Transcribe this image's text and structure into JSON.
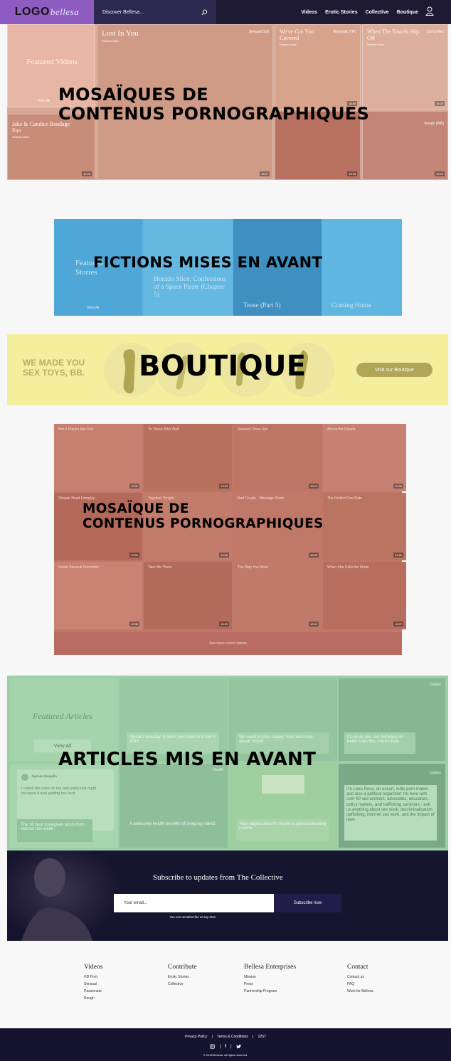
{
  "header": {
    "logo_text": "LOGO",
    "logo_script": "bellesa",
    "search_placeholder": "Discover Bellesa...",
    "nav": [
      "Videos",
      "Erotic Stories",
      "Collective",
      "Boutique"
    ]
  },
  "hero": {
    "overlay": [
      "MOSAÏQUES DE",
      "CONTENUS PORNOGRAPHIQUES"
    ],
    "featured_label": "Featured Videos",
    "view_all": "View All",
    "tiles": [
      {
        "title": "Lost In You",
        "sub": "Featured Video",
        "right": "Sensual Soft",
        "duration": "15:57"
      },
      {
        "title": "We've Got You Covered",
        "sub": "Featured Video",
        "right": "Romantic (HF)",
        "duration": "16:45"
      },
      {
        "title": "When The Towels Slip Off",
        "sub": "Featured Video",
        "right": "Sof to Rec",
        "duration": "14:28"
      },
      {
        "title": "Jake & Candice Bondage Fun",
        "sub": "Featured Video",
        "right": "",
        "duration": "15:28"
      },
      {
        "title": "",
        "sub": "",
        "right": "",
        "duration": "16:35"
      },
      {
        "title": "",
        "sub": "",
        "right": "Rough (WB)",
        "duration": "15:29"
      }
    ]
  },
  "fictions": {
    "overlay": "FICTIONS MISES EN AVANT",
    "label": "Featured Stories",
    "view_all": "View All",
    "stories": [
      "Horatio Slice: Confessions of a Space Pirate (Chapter 5)",
      "Tease (Part 5)",
      "Coming Home"
    ]
  },
  "boutique": {
    "tagline": [
      "WE MADE YOU",
      "SEX TOYS, BB."
    ],
    "overlay": "BOUTIQUE",
    "cta": "Visit our Boutique"
  },
  "mosaic2": {
    "overlay": [
      "MOSAÏQUE DE",
      "CONTENUS PORNOGRAPHIQUES"
    ],
    "see_more": "See more recent videos",
    "tiles": [
      {
        "title": "Hot & Playful Sex Roll",
        "duration": "13:32"
      },
      {
        "title": "To Those Who Wait",
        "duration": "10:29"
      },
      {
        "title": "Sensual Close-Ups",
        "duration": "15:25"
      },
      {
        "title": "Above the Clouds",
        "duration": "15:35"
      },
      {
        "title": "Shower Head Foreplay",
        "duration": "12:50"
      },
      {
        "title": "Together Tonight",
        "duration": "13:08"
      },
      {
        "title": "Bad Couple - Massage Room",
        "duration": "10:39"
      },
      {
        "title": "The Perfect First Date",
        "duration": "14:29"
      },
      {
        "title": "Sweet Sensual Surrender",
        "duration": "12:38"
      },
      {
        "title": "Take Me There",
        "duration": "13:23"
      },
      {
        "title": "The Way You Move",
        "duration": "12:43"
      },
      {
        "title": "When She Calls the Shots",
        "duration": "13:37"
      }
    ]
  },
  "articles": {
    "overlay": "ARTICLES MIS EN AVANT",
    "label": "Featured Articles",
    "view_all": "View All",
    "cards": [
      {
        "tag": "",
        "text": "Modern sexually: 8 items you need to know in 2018"
      },
      {
        "tag": "",
        "text": "We need to stop saying \"men are more visual\" ASAP"
      },
      {
        "tag": "Culture",
        "text": "Condom ads can definitely do better than this. Here's how"
      },
      {
        "tag": "",
        "text": "The 10 best Instagram posts from women this week"
      },
      {
        "tag": "Health",
        "text": "A awesome health benefits of sleeping naked"
      },
      {
        "tag": "",
        "text": "Your vagina doesn't require a special cleaning routine"
      },
      {
        "tag": "Culture",
        "text": "I'm Liara Roux, an escort, indie porn maker, and also a political organizer! I'm here with over 60 sex workers, advocates, educators, policy makers, and trafficking survivors - ask us anything about sex work, decriminalization, trafficking, internet sex work, and the impact of laws"
      }
    ],
    "tweet_name": "Jaymee Gargallo",
    "tweet_text": "I called the cops on my own party last night because it was getting too loud"
  },
  "subscribe": {
    "heading": "Subscribe to updates from The Collective",
    "placeholder": "Your email...",
    "button": "Subscribe now",
    "note": "You can unsubscribe at any time"
  },
  "footer": {
    "cols": [
      {
        "title": "Videos",
        "links": [
          "HD Porn",
          "Sensual",
          "Passionate",
          "Rough"
        ]
      },
      {
        "title": "Contribute",
        "links": [
          "Erotic Stories",
          "Collective"
        ]
      },
      {
        "title": "Bellesa Enterprises",
        "links": [
          "Mission",
          "Press",
          "Partnership Program"
        ]
      },
      {
        "title": "Contact",
        "links": [
          "Contact us",
          "FAQ",
          "Work for Bellesa"
        ]
      }
    ],
    "bottom_links": [
      "Privacy Policy",
      "Terms & Conditions",
      "2257"
    ],
    "copyright": "© 2018 Bellesa. All rights reserved."
  },
  "colors": {
    "header": "#1e1a34",
    "logo_bg": "#8e5cc0",
    "hero_overlay": "#d7a896",
    "fictions_overlay": "#5db5e0",
    "boutique_overlay": "#f4ef9c",
    "boutique_cta": "#b1a558",
    "mosaic_overlay": "#c1786a",
    "articles_overlay": "#9dcfa7",
    "subscribe_bg": "#171430"
  }
}
